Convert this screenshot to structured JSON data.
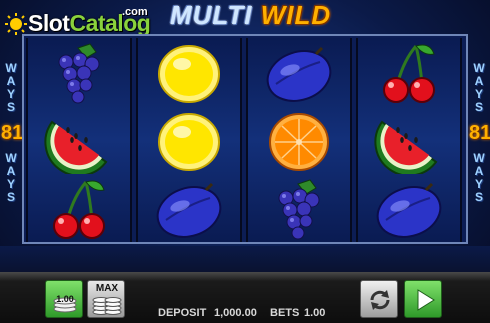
{
  "brand": {
    "slot": "Slot",
    "catalog": "Catalog",
    "com": ".com"
  },
  "title": {
    "multi": "MULTI",
    "wild": "WILD"
  },
  "ways": {
    "word": "WAYS",
    "count": "81"
  },
  "reels": [
    [
      "grapes-icon",
      "watermelon-icon",
      "cherries-icon"
    ],
    [
      "lemon-icon",
      "lemon-icon",
      "plum-icon"
    ],
    [
      "plum-icon",
      "orange-icon",
      "grapes-icon"
    ],
    [
      "cherries-icon",
      "watermelon-icon",
      "plum-icon"
    ]
  ],
  "controls": {
    "coin_value": "1.00",
    "max_label": "MAX"
  },
  "status": {
    "deposit_label": "DEPOSIT",
    "deposit_value": "1,000.00",
    "bets_label": "BETS",
    "bets_value": "1.00"
  },
  "colors": {
    "spin_button": "#2f9a2a",
    "title_wild": "#ffb000",
    "ways_number": "#ffb000"
  }
}
